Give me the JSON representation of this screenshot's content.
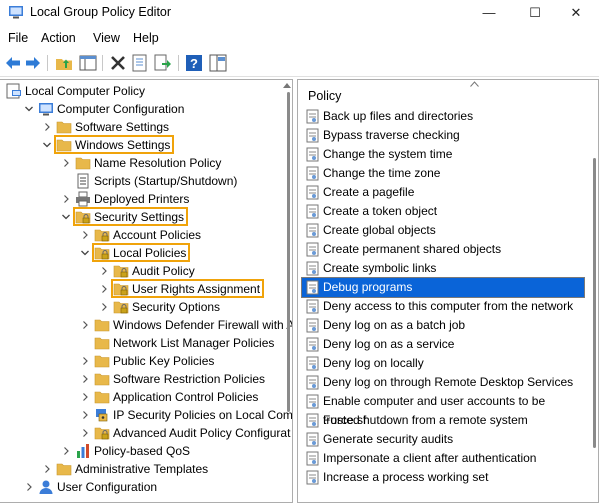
{
  "window": {
    "title": "Local Group Policy Editor",
    "minimize": "—",
    "maximize": "☐",
    "close": "✕"
  },
  "menu": [
    "File",
    "Action",
    "View",
    "Help"
  ],
  "toolbar_icons": [
    "back-arrow-icon",
    "forward-arrow-icon",
    "up-folder-icon",
    "show-hide-tree-icon",
    "delete-icon",
    "properties-icon",
    "export-list-icon",
    "help-icon",
    "extended-view-icon"
  ],
  "tree": {
    "items": [
      {
        "label": "Local Computer Policy",
        "icon": "policy-computer-icon",
        "highlight": false
      },
      {
        "label": "Computer Configuration",
        "icon": "computer-icon",
        "highlight": false
      },
      {
        "label": "Software Settings",
        "icon": "folder-icon",
        "highlight": false
      },
      {
        "label": "Windows Settings",
        "icon": "folder-icon",
        "highlight": true
      },
      {
        "label": "Name Resolution Policy",
        "icon": "folder-icon",
        "highlight": false
      },
      {
        "label": "Scripts (Startup/Shutdown)",
        "icon": "script-icon",
        "highlight": false
      },
      {
        "label": "Deployed Printers",
        "icon": "printer-icon",
        "highlight": false
      },
      {
        "label": "Security Settings",
        "icon": "security-folder-icon",
        "highlight": true
      },
      {
        "label": "Account Policies",
        "icon": "security-folder-icon",
        "highlight": false
      },
      {
        "label": "Local Policies",
        "icon": "security-folder-icon",
        "highlight": true
      },
      {
        "label": "Audit Policy",
        "icon": "security-folder-icon",
        "highlight": false
      },
      {
        "label": "User Rights Assignment",
        "icon": "security-folder-icon",
        "highlight": true
      },
      {
        "label": "Security Options",
        "icon": "security-folder-icon",
        "highlight": false
      },
      {
        "label": "Windows Defender Firewall with A",
        "icon": "folder-icon",
        "highlight": false
      },
      {
        "label": "Network List Manager Policies",
        "icon": "folder-icon",
        "highlight": false
      },
      {
        "label": "Public Key Policies",
        "icon": "folder-icon",
        "highlight": false
      },
      {
        "label": "Software Restriction Policies",
        "icon": "folder-icon",
        "highlight": false
      },
      {
        "label": "Application Control Policies",
        "icon": "folder-icon",
        "highlight": false
      },
      {
        "label": "IP Security Policies on Local Comp",
        "icon": "ip-security-icon",
        "highlight": false
      },
      {
        "label": "Advanced Audit Policy Configurat",
        "icon": "security-folder-icon",
        "highlight": false
      },
      {
        "label": "Policy-based QoS",
        "icon": "qos-chart-icon",
        "highlight": false
      },
      {
        "label": "Administrative Templates",
        "icon": "folder-icon",
        "highlight": false
      },
      {
        "label": "User Configuration",
        "icon": "user-icon",
        "highlight": false
      }
    ]
  },
  "policy": {
    "header": "Policy",
    "items": [
      "Back up files and directories",
      "Bypass traverse checking",
      "Change the system time",
      "Change the time zone",
      "Create a pagefile",
      "Create a token object",
      "Create global objects",
      "Create permanent shared objects",
      "Create symbolic links",
      "Debug programs",
      "Deny access to this computer from the network",
      "Deny log on as a batch job",
      "Deny log on as a service",
      "Deny log on locally",
      "Deny log on through Remote Desktop Services",
      "Enable computer and user accounts to be trusted f",
      "Force shutdown from a remote system",
      "Generate security audits",
      "Impersonate a client after authentication",
      "Increase a process working set"
    ],
    "selected": "Debug programs"
  },
  "colors": {
    "highlight_outline": "#f0a30a",
    "selection": "#0a64d8",
    "folder": "#e8b84a"
  }
}
